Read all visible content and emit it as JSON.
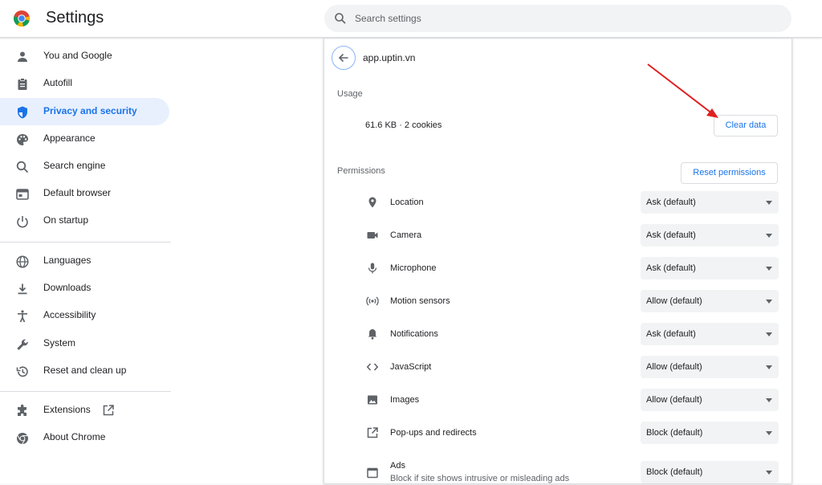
{
  "header": {
    "title": "Settings",
    "search_placeholder": "Search settings"
  },
  "sidebar": {
    "items": [
      {
        "label": "You and Google",
        "icon": "person-icon"
      },
      {
        "label": "Autofill",
        "icon": "clipboard-icon"
      },
      {
        "label": "Privacy and security",
        "icon": "shield-icon",
        "active": true
      },
      {
        "label": "Appearance",
        "icon": "palette-icon"
      },
      {
        "label": "Search engine",
        "icon": "search-icon"
      },
      {
        "label": "Default browser",
        "icon": "browser-icon"
      },
      {
        "label": "On startup",
        "icon": "power-icon"
      },
      {
        "label": "Languages",
        "icon": "globe-icon"
      },
      {
        "label": "Downloads",
        "icon": "download-icon"
      },
      {
        "label": "Accessibility",
        "icon": "accessibility-icon"
      },
      {
        "label": "System",
        "icon": "wrench-icon"
      },
      {
        "label": "Reset and clean up",
        "icon": "history-icon"
      },
      {
        "label": "Extensions",
        "icon": "puzzle-icon"
      },
      {
        "label": "About Chrome",
        "icon": "chrome-icon"
      }
    ]
  },
  "site": {
    "name": "app.uptin.vn",
    "usage_label": "Usage",
    "usage_text": "61.6 KB · 2 cookies",
    "clear_button": "Clear data",
    "permissions_label": "Permissions",
    "reset_button": "Reset permissions",
    "permissions": [
      {
        "label": "Location",
        "value": "Ask (default)",
        "icon": "location-pin-icon"
      },
      {
        "label": "Camera",
        "value": "Ask (default)",
        "icon": "camera-icon"
      },
      {
        "label": "Microphone",
        "value": "Ask (default)",
        "icon": "microphone-icon"
      },
      {
        "label": "Motion sensors",
        "value": "Allow (default)",
        "icon": "sensors-icon"
      },
      {
        "label": "Notifications",
        "value": "Ask (default)",
        "icon": "bell-icon"
      },
      {
        "label": "JavaScript",
        "value": "Allow (default)",
        "icon": "code-icon"
      },
      {
        "label": "Images",
        "value": "Allow (default)",
        "icon": "image-icon"
      },
      {
        "label": "Pop-ups and redirects",
        "value": "Block (default)",
        "icon": "popup-icon"
      },
      {
        "label": "Ads",
        "sublabel": "Block if site shows intrusive or misleading ads",
        "value": "Block (default)",
        "icon": "ads-window-icon"
      }
    ]
  },
  "colors": {
    "accent": "#1a73e8",
    "active_bg": "#e8f0fe",
    "annotation_arrow": "#e02020"
  }
}
